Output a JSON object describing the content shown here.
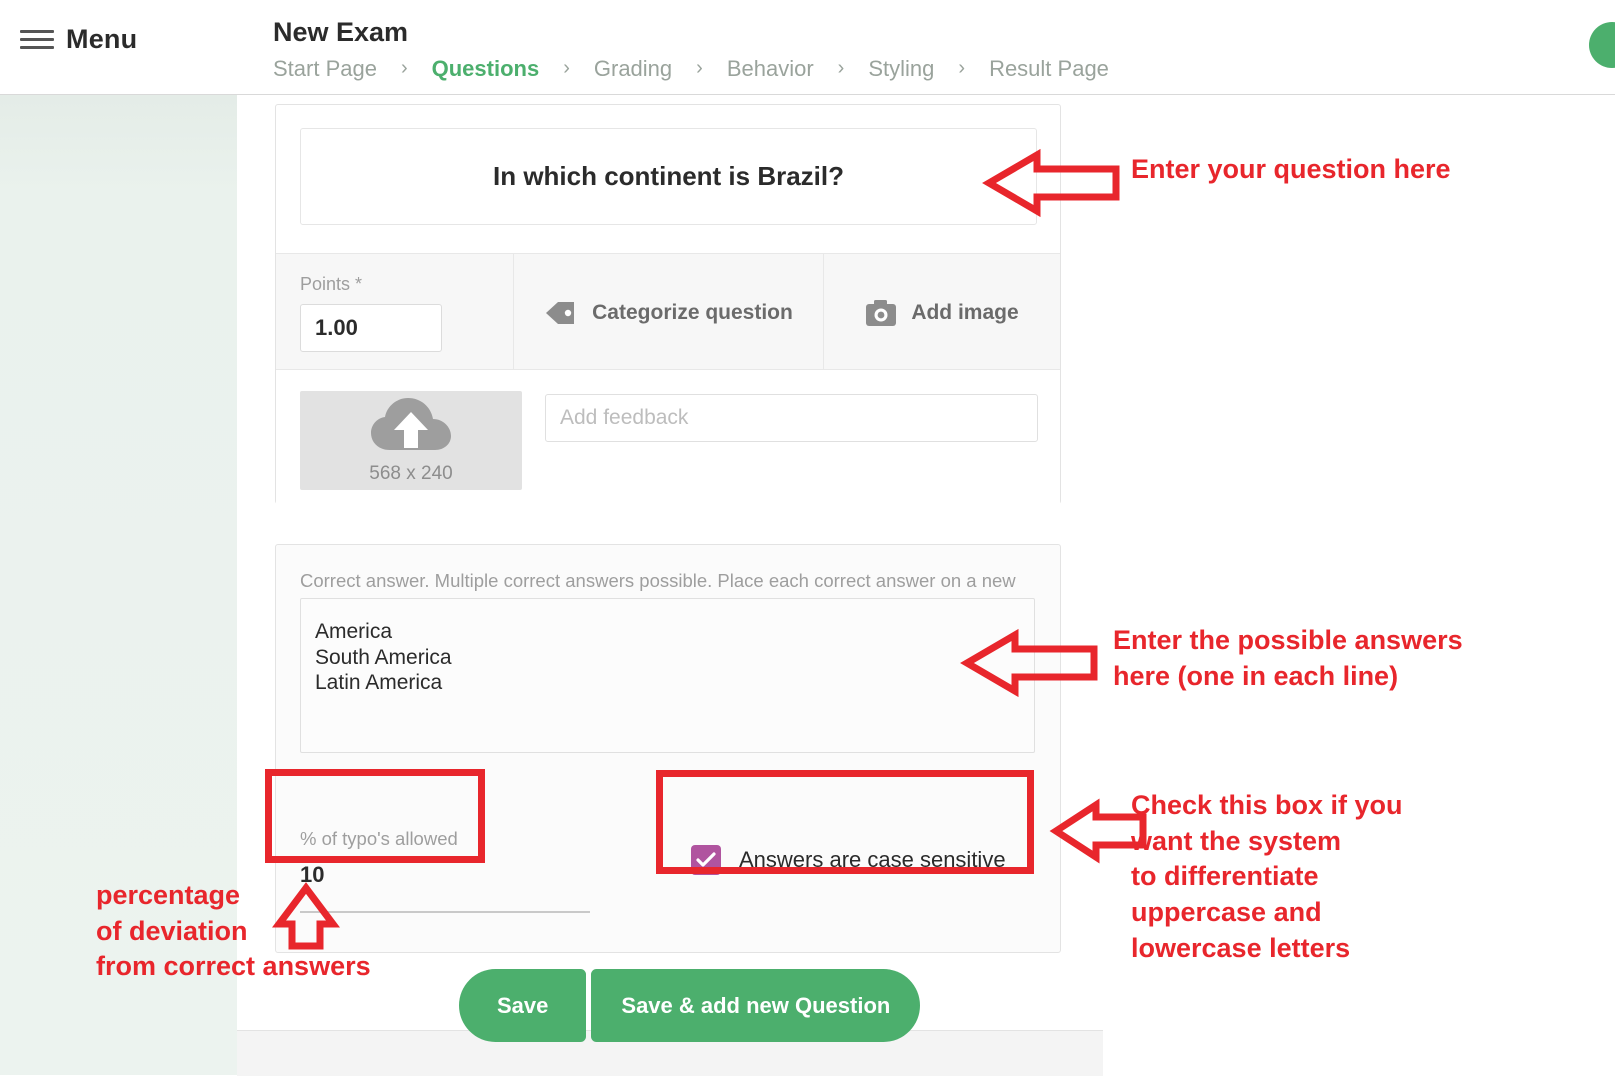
{
  "header": {
    "menu_label": "Menu",
    "title": "New Exam",
    "breadcrumb": [
      {
        "label": "Start Page",
        "active": false
      },
      {
        "label": "Questions",
        "active": true
      },
      {
        "label": "Grading",
        "active": false
      },
      {
        "label": "Behavior",
        "active": false
      },
      {
        "label": "Styling",
        "active": false
      },
      {
        "label": "Result Page",
        "active": false
      }
    ],
    "separator": "›",
    "avatar_color": "#4caf6d"
  },
  "question_card": {
    "question_text": "In which continent is Brazil?",
    "points_label": "Points *",
    "points_value": "1.00",
    "categorize_label": "Categorize question",
    "categorize_icon": "tag-icon",
    "add_image_label": "Add image",
    "add_image_icon": "camera-icon",
    "upload_icon": "cloud-upload-icon",
    "upload_dimensions": "568 x 240",
    "feedback_placeholder": "Add feedback"
  },
  "answer_card": {
    "hint": "Correct answer. Multiple correct answers possible. Place each correct answer on a new line. *",
    "answers": [
      "America",
      "South America",
      "Latin America"
    ],
    "typo_label": "% of typo's allowed",
    "typo_value": "10",
    "case_sensitive_label": "Answers are case sensitive",
    "case_sensitive_checked": true,
    "checkbox_color": "#b0549f"
  },
  "footer": {
    "save_label": "Save",
    "save_add_label": "Save & add new Question",
    "button_color": "#4caf6d"
  },
  "annotations": {
    "color": "#e8262c",
    "question": "Enter your question here",
    "answers": "Enter the possible answers\nhere (one in each line)",
    "case_sensitive": "Check this box if you\nwant the system\nto differentiate\nuppercase and\nlowercase letters",
    "typo": "percentage\nof deviation\nfrom correct answers"
  }
}
